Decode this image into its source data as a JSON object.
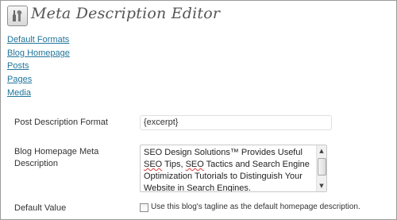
{
  "header": {
    "title": "Meta Description Editor",
    "icon": "plugin-tools-icon"
  },
  "nav": {
    "links": [
      {
        "label": "Default Formats"
      },
      {
        "label": "Blog Homepage"
      },
      {
        "label": "Posts"
      },
      {
        "label": "Pages"
      },
      {
        "label": "Media"
      }
    ]
  },
  "form": {
    "post_description_format": {
      "label": "Post Description Format",
      "value": "{excerpt}"
    },
    "blog_homepage_meta": {
      "label_line1": "Blog Homepage Meta",
      "label_line2": "Description",
      "value_part1": "SEO Design Solutions™ Provides Useful ",
      "value_seo1": "SEO",
      "value_part2": " Tips, ",
      "value_seo2": "SEO",
      "value_part3": " Tactics and Search Engine Optimization Tutorials to Distinguish Your Website in Search Engines."
    },
    "default_value": {
      "label": "Default Value",
      "checkbox_label": "Use this blog's tagline as the default homepage description.",
      "checked": false
    }
  },
  "colors": {
    "link": "#21759b",
    "title": "#555555",
    "text": "#333333",
    "spellcheck": "#e23a3a"
  }
}
